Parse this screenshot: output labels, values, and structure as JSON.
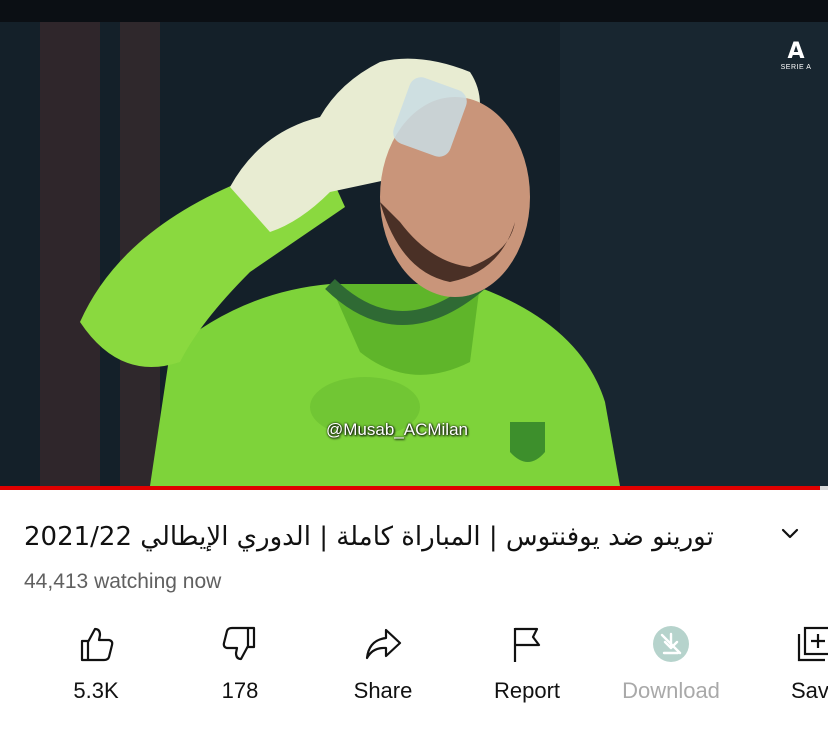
{
  "video": {
    "watermark": "@Musab_ACMilan",
    "league_badge": {
      "mark": "A",
      "name": "SERIE A"
    },
    "progress_fraction": 0.99
  },
  "title": "تورينو ضد يوفنتوس | المباراة كاملة | الدوري الإيطالي 2021/22",
  "viewers": "44,413 watching now",
  "actions": [
    {
      "label": "5.3K",
      "icon": "thumbs-up-icon",
      "enabled": true
    },
    {
      "label": "178",
      "icon": "thumbs-down-icon",
      "enabled": true
    },
    {
      "label": "Share",
      "icon": "share-icon",
      "enabled": true
    },
    {
      "label": "Report",
      "icon": "flag-icon",
      "enabled": true
    },
    {
      "label": "Download",
      "icon": "download-icon",
      "enabled": false
    },
    {
      "label": "Save",
      "icon": "save-playlist-icon",
      "enabled": true
    }
  ],
  "colors": {
    "accent": "#e00000",
    "text": "#0f0f0f",
    "secondary_text": "#606060",
    "disabled_text": "#a9a9a9",
    "download_icon_bg": "#b6d3cc"
  }
}
